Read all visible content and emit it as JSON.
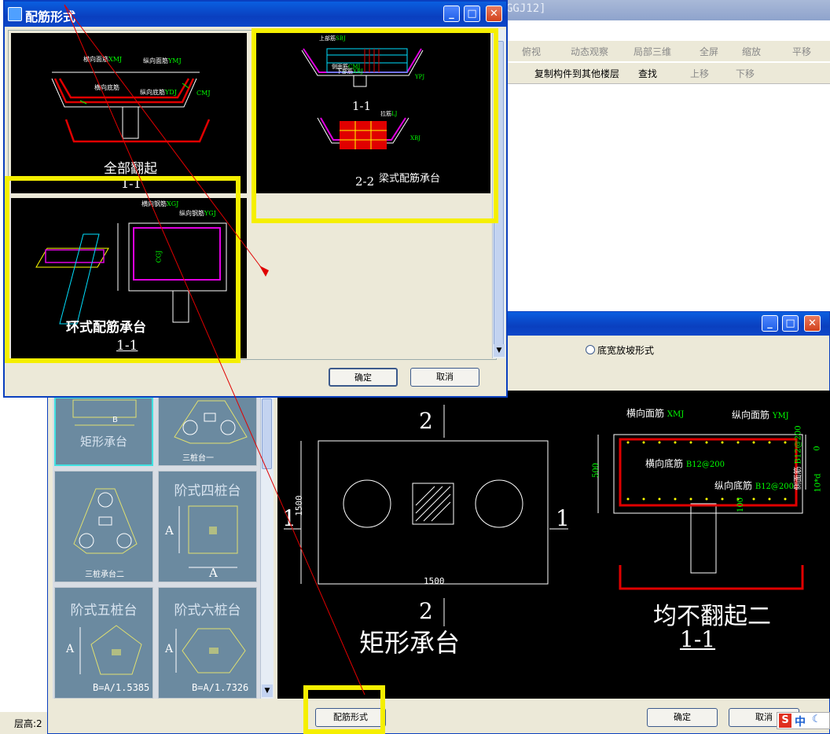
{
  "background_app": {
    "title_fragment": "GGJ12]",
    "toolbar_row1": [
      "俯视",
      "动态观察",
      "局部三维",
      "全屏",
      "缩放",
      "平移"
    ],
    "toolbar_row2": [
      "复制构件到其他楼层",
      "查找",
      "上移",
      "下移"
    ],
    "status_label": "层高:2"
  },
  "main_dialog": {
    "radio_label": "底宽放坡形式",
    "thumbnails": [
      {
        "title": "矩形承台"
      },
      {
        "title": "三桩台一"
      },
      {
        "title": "三桩承台二"
      },
      {
        "title": "阶式四桩台",
        "dim": "A"
      },
      {
        "title": "阶式五桩台",
        "dim": "A",
        "formula": "B=A/1.5385"
      },
      {
        "title": "阶式六桩台",
        "dim": "A",
        "formula": "B=A/1.7326"
      }
    ],
    "preview": {
      "plan_name": "矩形承台",
      "section_mark": "2",
      "side_mark": "1",
      "width_dim": "1500",
      "height_dim": "1500",
      "section_title": "均不翻起二",
      "section_id": "1-1",
      "labels": {
        "top_x": "横向面筋",
        "top_x_code": "XMJ",
        "top_y": "纵向面筋",
        "top_y_code": "YMJ",
        "bot_x": "横向底筋",
        "bot_x_code": "B12@200",
        "bot_y": "纵向底筋",
        "bot_y_code": "B12@200",
        "side": "侧面筋",
        "side_code": "B12@200",
        "height": "500",
        "cover": "100",
        "right_a": "0",
        "right_b": "10*d"
      }
    },
    "rebar_button": "配筋形式",
    "ok_button": "确定",
    "cancel_button": "取消"
  },
  "rebar_dialog": {
    "title": "配筋形式",
    "options": [
      {
        "caption": "全部翻起",
        "id": "1-1",
        "labels": [
          "横向面筋",
          "XMJ",
          "纵向面筋",
          "YMJ",
          "横向底筋",
          "纵向底筋",
          "YDJ",
          "CMJ"
        ]
      },
      {
        "caption": "梁式配筋承台",
        "id1": "1-1",
        "id2": "2-2",
        "labels": [
          "上部筋",
          "SBJ",
          "下部筋",
          "XBJ",
          "侧面筋",
          "CMJ",
          "YPJ",
          "拉筋",
          "LJ",
          "XBJ"
        ]
      },
      {
        "caption": "环式配筋承台",
        "id": "1-1",
        "labels": [
          "横向钢筋",
          "XGJ",
          "纵向钢筋",
          "YGJ",
          "CGJ"
        ]
      }
    ],
    "ok_button": "确定",
    "cancel_button": "取消"
  },
  "ime": {
    "logo": "S",
    "text": "中"
  },
  "colors": {
    "highlight": "#f5ef00",
    "annotation_arrow": "#e00000",
    "cad_bg": "#000000"
  }
}
